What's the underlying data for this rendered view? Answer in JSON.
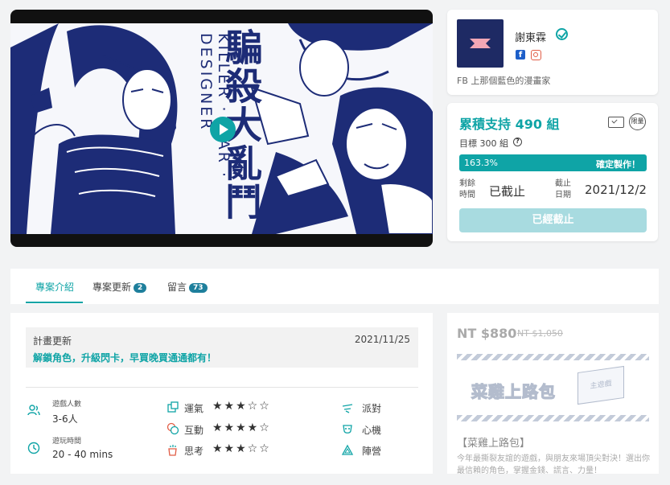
{
  "video": {
    "title_art": "騙殺大亂鬥",
    "subtitle_art": "KILLER · LIAR · DESIGNER"
  },
  "creator": {
    "name": "謝東霖",
    "bio": "FB 上那個藍色的漫畫家",
    "icons": [
      "verified-icon",
      "facebook-icon",
      "instagram-icon"
    ]
  },
  "funding": {
    "backed": "累積支持 490 組",
    "limited_badge": "限量",
    "goal": "目標 300 組",
    "progress_label": "163.3%",
    "progress_fraction": 1.0,
    "confirm_label": "確定製作！",
    "remaining_label_1": "剩餘",
    "remaining_label_2": "時間",
    "remaining_value": "已截止",
    "deadline_label_1": "截止",
    "deadline_label_2": "日期",
    "deadline_value": "2021/12/2",
    "ended_button": "已經截止"
  },
  "tabs": [
    {
      "label": "專案介紹",
      "badge": ""
    },
    {
      "label": "專案更新",
      "badge": "2"
    },
    {
      "label": "留言",
      "badge": "73"
    }
  ],
  "update": {
    "label": "計畫更新",
    "date": "2021/11/25",
    "message": "解鎖角色，升級閃卡，早買晚買通通都有！"
  },
  "stats": {
    "players_label": "遊戲人數",
    "players_value": "3-6人",
    "time_label": "遊玩時間",
    "time_value": "20 - 40 mins"
  },
  "attributes": [
    {
      "name": "運氣",
      "stars": "★★★☆☆"
    },
    {
      "name": "互動",
      "stars": "★★★★☆"
    },
    {
      "name": "思考",
      "stars": "★★★☆☆"
    }
  ],
  "tags": [
    "派對",
    "心機",
    "陣營"
  ],
  "reward": {
    "price": "NT $880",
    "original_price": "NT $1,050",
    "art_title": "菜雞上路包",
    "box_label": "主遊戲",
    "name": "【菜雞上路包】",
    "description": "今年最撕裂友誼的遊戲，與朋友來場頂尖對決！選出你最信賴的角色，掌握金錢、謊言、力量！"
  },
  "colors": {
    "accent": "#0fa4a6",
    "art_ink": "#1d2c77"
  }
}
